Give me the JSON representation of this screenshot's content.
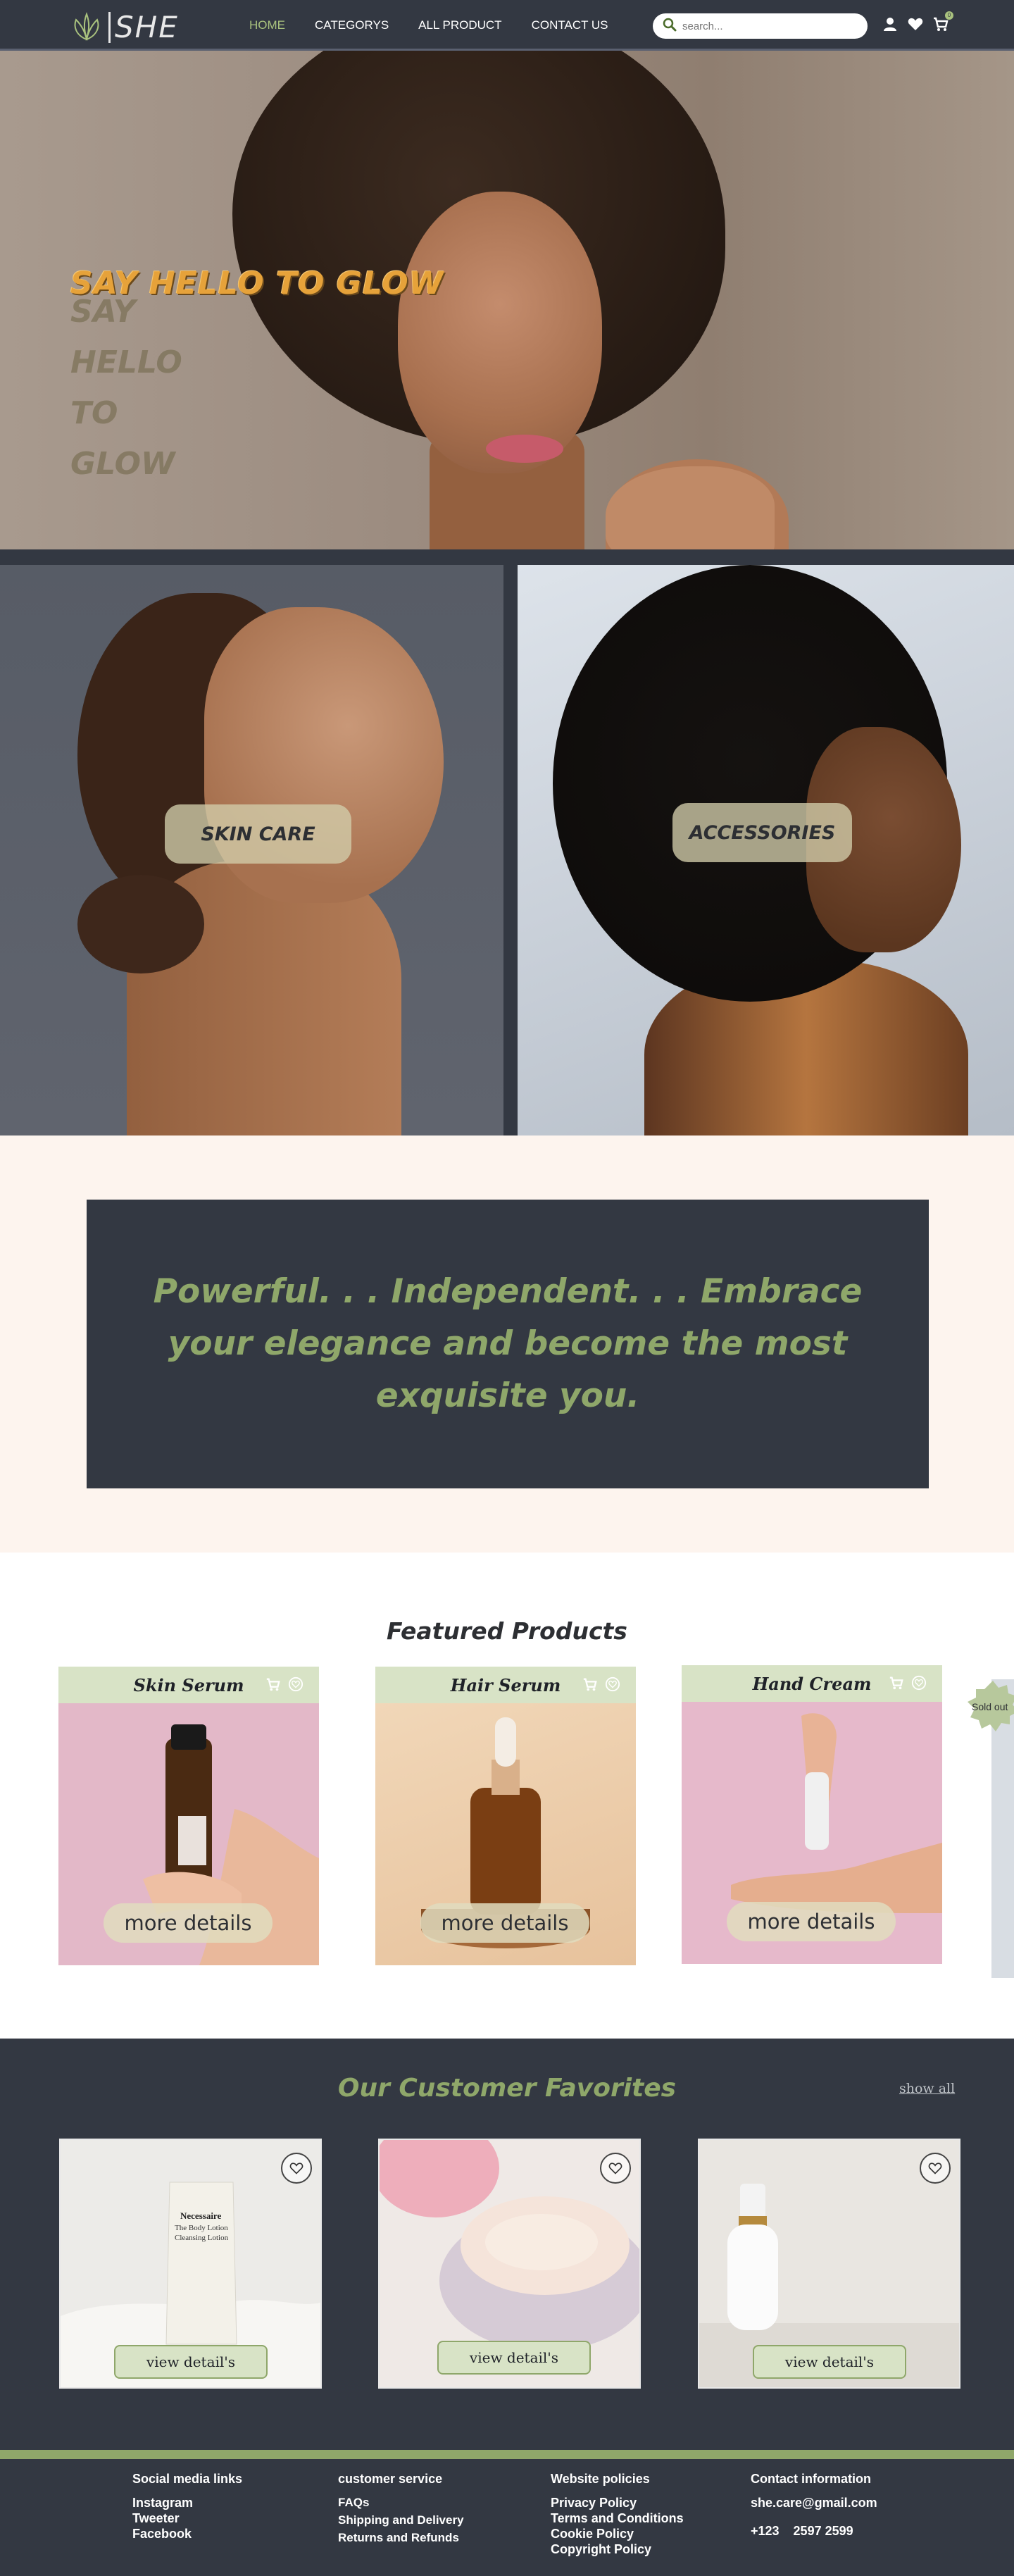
{
  "nav": {
    "logo_text": "SHE",
    "links": [
      "HOME",
      "CATEGORYS",
      "ALL PRODUCT",
      "CONTACT US"
    ],
    "search_placeholder": "search...",
    "cart_count": "0"
  },
  "hero": {
    "title": "SAY HELLO TO GLOW",
    "shadow_lines": [
      "SAY",
      "HELLO",
      "TO",
      "GLOW"
    ]
  },
  "categories": [
    {
      "label": "SKIN CARE"
    },
    {
      "label": "ACCESSORIES"
    }
  ],
  "quote": {
    "text": "Powerful. . . Independent. . . Embrace your elegance and become the most exquisite you."
  },
  "featured": {
    "title": "Featured Products",
    "products": [
      {
        "name": "Skin Serum",
        "button": "more details"
      },
      {
        "name": "Hair Serum",
        "button": "more details"
      },
      {
        "name": "Hand Cream",
        "button": "more details"
      }
    ],
    "badge": "Sold out"
  },
  "favorites": {
    "title": "Our Customer Favorites",
    "show_all": "show all",
    "items": [
      {
        "button": "view detail's",
        "brand": "Necessaire",
        "product": "The Body Lotion",
        "note": "Cleansing Lotion"
      },
      {
        "button": "view detail's"
      },
      {
        "button": "view detail's"
      }
    ]
  },
  "footer": {
    "columns": [
      {
        "heading": "Social media links",
        "items": [
          "Instagram",
          "Tweeter",
          "Facebook"
        ]
      },
      {
        "heading": "customer service",
        "items": [
          "FAQs",
          "Shipping and Delivery",
          "Returns and Refunds"
        ]
      },
      {
        "heading": "Website policies",
        "items": [
          "Privacy Policy",
          "Terms and Conditions",
          "Cookie Policy",
          "Copyright Policy"
        ]
      },
      {
        "heading": "Contact information",
        "items": [
          "she.care@gmail.com",
          "+123    2597 2599"
        ]
      }
    ]
  },
  "colors": {
    "dark": "#333842",
    "accent_green": "#8fa76a",
    "accent_orange": "#e6a23a",
    "cream": "#fdf4ee",
    "card_header": "#d8e3c6"
  }
}
